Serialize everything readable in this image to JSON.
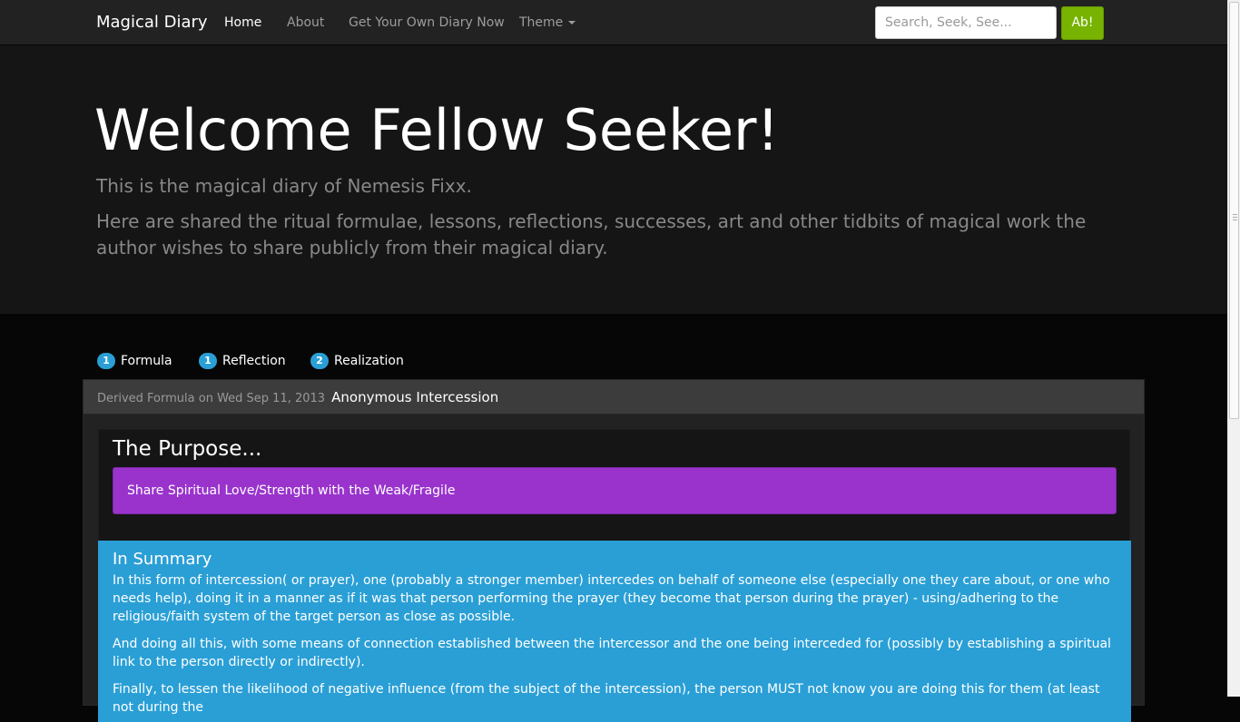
{
  "navbar": {
    "brand": "Magical Diary",
    "links": [
      {
        "label": "Home",
        "active": true
      },
      {
        "label": "About"
      },
      {
        "label": "Get Your Own Diary Now"
      },
      {
        "label": "Theme"
      }
    ],
    "search": {
      "placeholder": "Search, Seek, See...",
      "value": "",
      "button_label": "Ab!"
    }
  },
  "jumbotron": {
    "heading": "Welcome Fellow Seeker!",
    "lead_1": "This is the magical diary of Nemesis Fixx.",
    "lead_2": "Here are shared the ritual formulae, lessons, reflections, successes, art and other tidbits of magical work the author wishes to share publicly from their magical diary."
  },
  "tabs": [
    {
      "count": "1",
      "label": "Formula"
    },
    {
      "count": "1",
      "label": "Reflection"
    },
    {
      "count": "2",
      "label": "Realization"
    }
  ],
  "entry": {
    "meta": "Derived Formula on Wed Sep 11, 2013",
    "title": "Anonymous Intercession",
    "purpose_heading": "The Purpose...",
    "purpose_text": "Share Spiritual Love/Strength with the Weak/Fragile",
    "summary_heading": "In Summary",
    "summary_paragraphs": [
      "In this form of intercession( or prayer), one (probably a stronger member) intercedes on behalf of someone else (especially one they care about, or one who needs help), doing it in a manner as if it was that person performing the prayer (they become that person during the prayer) - using/adhering to the religious/faith system of the target person as close as possible.",
      "And doing all this, with some means of connection established between the intercessor and the one being interceded for (possibly by establishing a spiritual link to the person directly or indirectly).",
      "Finally, to lessen the likelihood of negative influence (from the subject of the intercession), the person MUST not know you are doing this for them (at least not during the"
    ]
  },
  "colors": {
    "navbar_bg": "#222222",
    "success": "#77b300",
    "primary": "#2a9fd6",
    "purple": "#9933cc"
  }
}
